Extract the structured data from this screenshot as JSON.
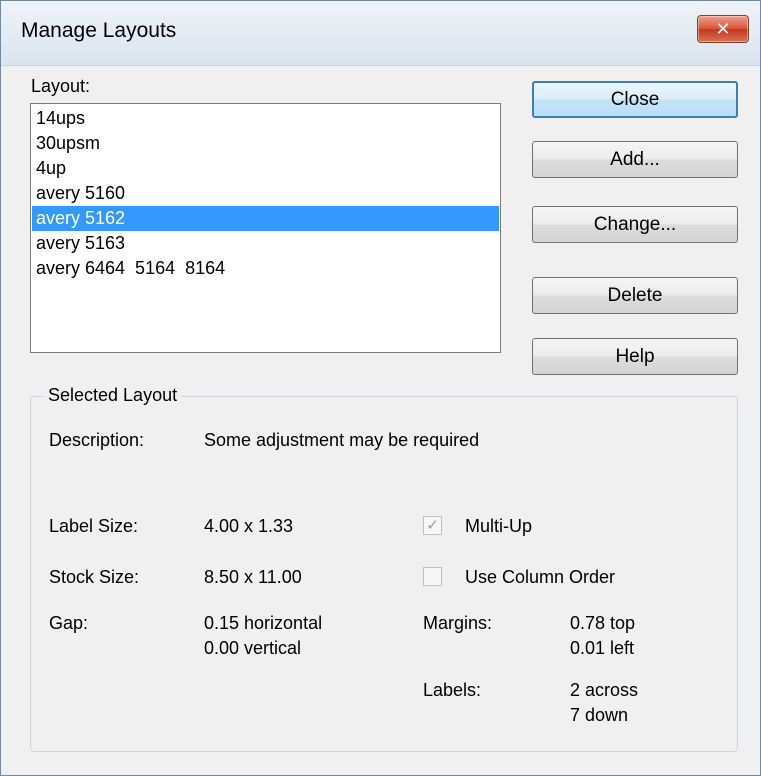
{
  "window": {
    "title": "Manage Layouts",
    "close_glyph": "✕"
  },
  "layout_list": {
    "label": "Layout:",
    "items": [
      "14ups",
      "30upsm",
      "4up",
      "avery 5160",
      "avery 5162",
      "avery 5163",
      "avery 6464  5164  8164"
    ],
    "selected_index": 4
  },
  "buttons": {
    "close": "Close",
    "add": "Add...",
    "change": "Change...",
    "delete": "Delete",
    "help": "Help"
  },
  "selected_layout": {
    "group_title": "Selected Layout",
    "description_label": "Description:",
    "description_value": "Some adjustment may be required",
    "label_size_label": "Label Size:",
    "label_size_value": "4.00 x 1.33",
    "stock_size_label": "Stock Size:",
    "stock_size_value": "8.50 x 11.00",
    "gap_label": "Gap:",
    "gap_horizontal": "0.15 horizontal",
    "gap_vertical": "0.00 vertical",
    "multi_up_label": "Multi-Up",
    "multi_up_checked": true,
    "column_order_label": "Use Column Order",
    "column_order_checked": false,
    "margins_label": "Margins:",
    "margins_top": "0.78 top",
    "margins_left": "0.01 left",
    "labels_label": "Labels:",
    "labels_across": "2 across",
    "labels_down": "7 down"
  },
  "colors": {
    "selection": "#3399ff",
    "close_button": "#c4361d"
  }
}
